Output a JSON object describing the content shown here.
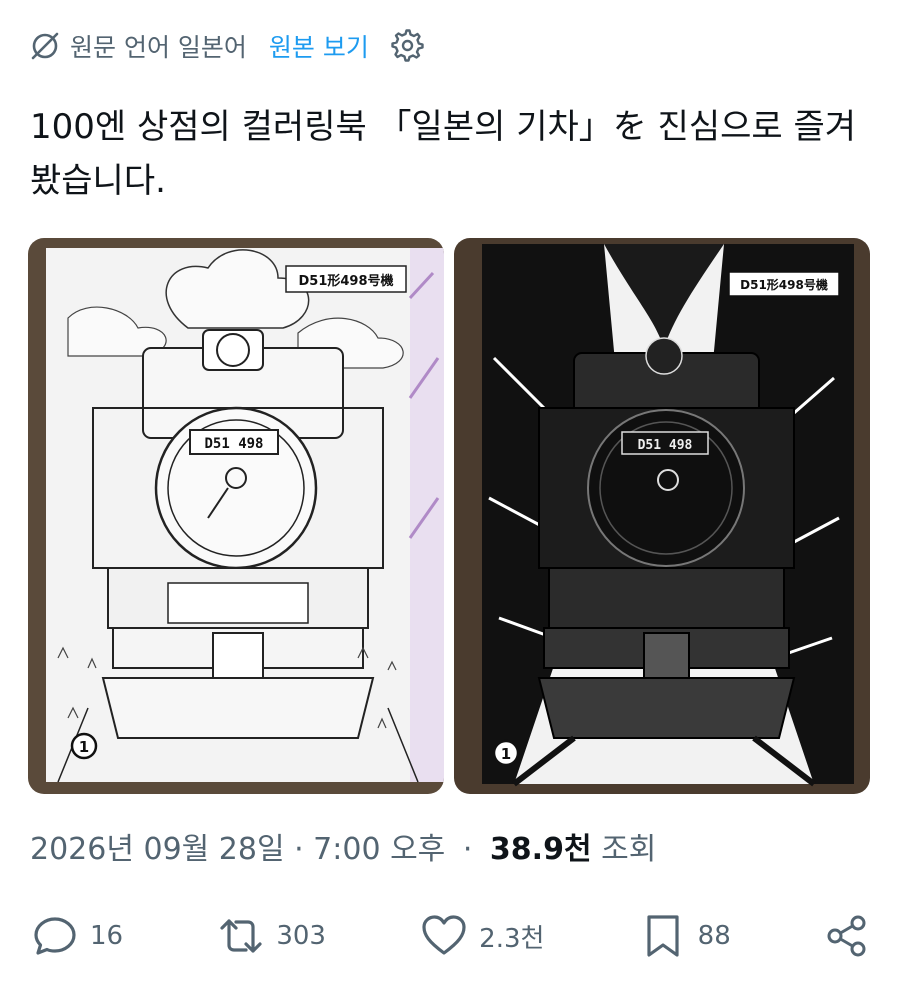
{
  "translation": {
    "source_language": "원문 언어 일본어",
    "show_original": "원본 보기",
    "icons": {
      "globe": "translate-globe-icon",
      "settings": "gear-icon"
    }
  },
  "tweet": {
    "text": "100엔 상점의 컬러링북 「일본의 기차」を 진심으로 즐겨봤습니다."
  },
  "media": {
    "left_image": {
      "plate_label": "D51形498号機",
      "number_plate": "D51 498",
      "page_number": "1"
    },
    "right_image": {
      "plate_label": "D51形498号機",
      "number_plate": "D51 498",
      "page_number": "1"
    }
  },
  "meta": {
    "timestamp": "2026년 09월 28일 · 7:00 오후",
    "separator": "·",
    "views_count": "38.9천",
    "views_label": "조회"
  },
  "actions": {
    "reply_count": "16",
    "retweet_count": "303",
    "like_count": "2.3천",
    "bookmark_count": "88"
  }
}
